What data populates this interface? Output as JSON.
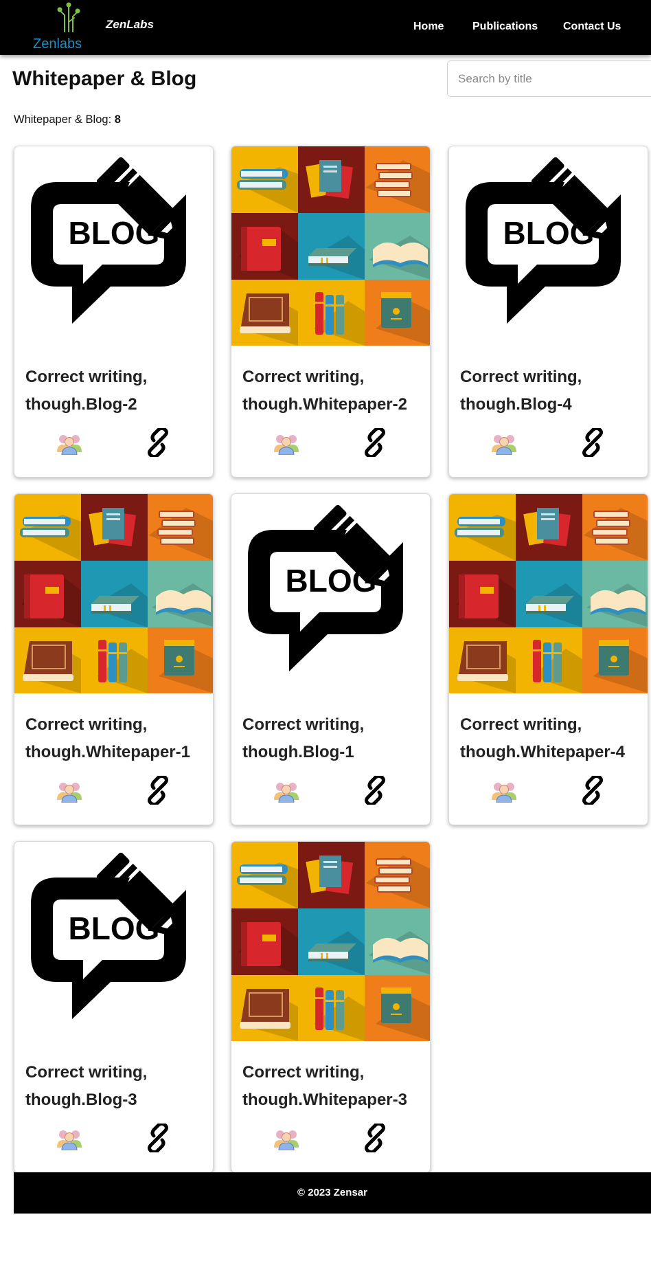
{
  "brand": {
    "logo_text": "Zenlabs",
    "name": "ZenLabs"
  },
  "nav": {
    "home": "Home",
    "publications": "Publications",
    "contact": "Contact Us"
  },
  "page": {
    "title": "Whitepaper & Blog",
    "search_placeholder": "Search by title",
    "count_label": "Whitepaper & Blog:",
    "count_value": "8"
  },
  "cards": [
    {
      "title": "Correct writing, though.Blog-2",
      "image": "blog-icon"
    },
    {
      "title": "Correct writing, though.Whitepaper-2",
      "image": "books-grid-image"
    },
    {
      "title": "Correct writing, though.Blog-4",
      "image": "blog-icon"
    },
    {
      "title": "Correct writing, though.Whitepaper-1",
      "image": "books-grid-image"
    },
    {
      "title": "Correct writing, though.Blog-1",
      "image": "blog-icon"
    },
    {
      "title": "Correct writing, though.Whitepaper-4",
      "image": "books-grid-image"
    },
    {
      "title": "Correct writing, though.Blog-3",
      "image": "blog-icon"
    },
    {
      "title": "Correct writing, though.Whitepaper-3",
      "image": "books-grid-image"
    }
  ],
  "icons": {
    "author": "authors-icon",
    "link": "link-icon"
  },
  "colors": {
    "navbar": "#000000",
    "logo_green": "#7cc142",
    "logo_blue": "#1c8fc4"
  },
  "footer": {
    "text": "© 2023 Zensar"
  }
}
